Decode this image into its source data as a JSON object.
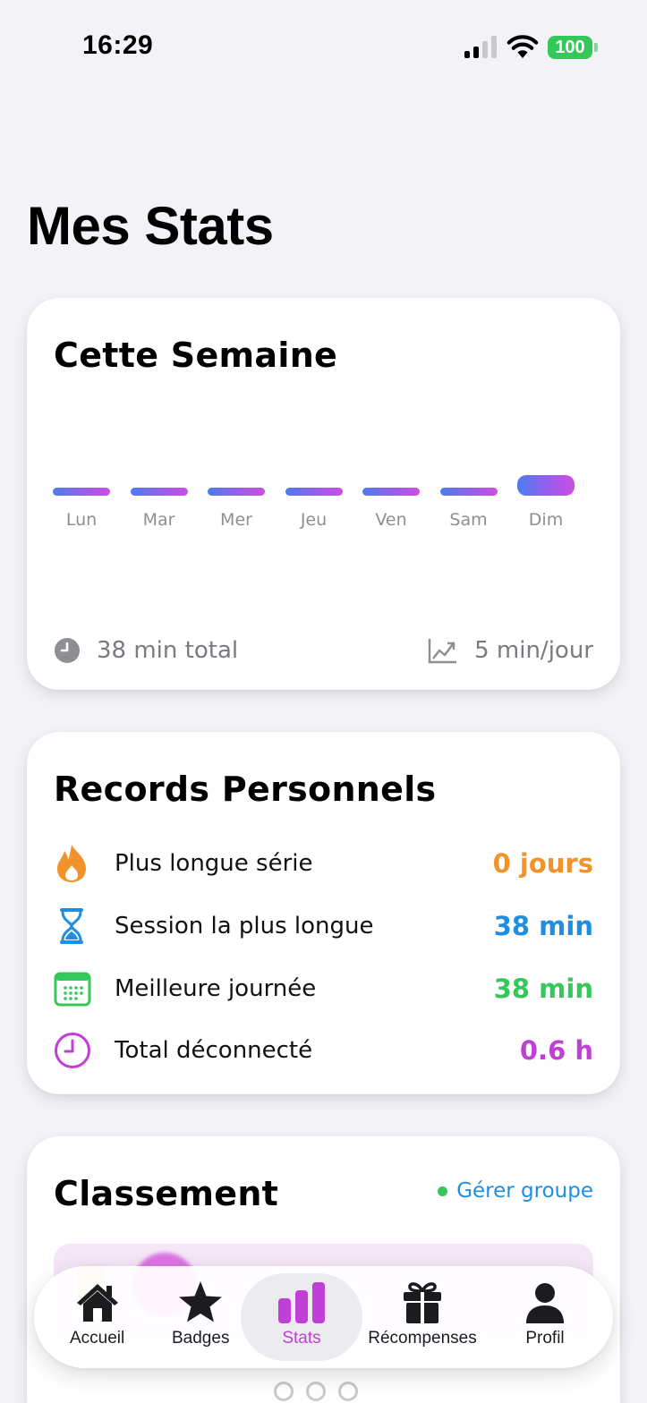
{
  "status_bar": {
    "time": "16:29",
    "battery": "100"
  },
  "page_title": "Mes Stats",
  "week": {
    "title": "Cette Semaine",
    "days": [
      {
        "label": "Lun",
        "minutes": 0
      },
      {
        "label": "Mar",
        "minutes": 0
      },
      {
        "label": "Mer",
        "minutes": 0
      },
      {
        "label": "Jeu",
        "minutes": 0
      },
      {
        "label": "Ven",
        "minutes": 0
      },
      {
        "label": "Sam",
        "minutes": 0
      },
      {
        "label": "Dim",
        "minutes": 38
      }
    ],
    "total": "38 min total",
    "average": "5 min/jour"
  },
  "records": {
    "title": "Records Personnels",
    "items": [
      {
        "icon": "flame-icon",
        "label": "Plus longue série",
        "value": "0 jours",
        "color": "#f0932b"
      },
      {
        "icon": "hourglass-icon",
        "label": "Session la plus longue",
        "value": "38 min",
        "color": "#1e8fe0"
      },
      {
        "icon": "calendar-icon",
        "label": "Meilleure journée",
        "value": "38 min",
        "color": "#34c759"
      },
      {
        "icon": "clock-icon",
        "label": "Total déconnecté",
        "value": "0.6 h",
        "color": "#c13fd6"
      }
    ]
  },
  "ranking": {
    "title": "Classement",
    "manage_label": "Gérer groupe"
  },
  "tabs": [
    {
      "id": "home",
      "label": "Accueil",
      "icon": "house-icon"
    },
    {
      "id": "badges",
      "label": "Badges",
      "icon": "star-icon"
    },
    {
      "id": "stats",
      "label": "Stats",
      "icon": "bar-chart-icon",
      "active": true
    },
    {
      "id": "rewards",
      "label": "Récompenses",
      "icon": "gift-icon"
    },
    {
      "id": "profile",
      "label": "Profil",
      "icon": "person-icon"
    }
  ],
  "colors": {
    "accent": "#c13fd6",
    "orange": "#f0932b",
    "blue": "#1e8fe0",
    "green": "#34c759"
  }
}
